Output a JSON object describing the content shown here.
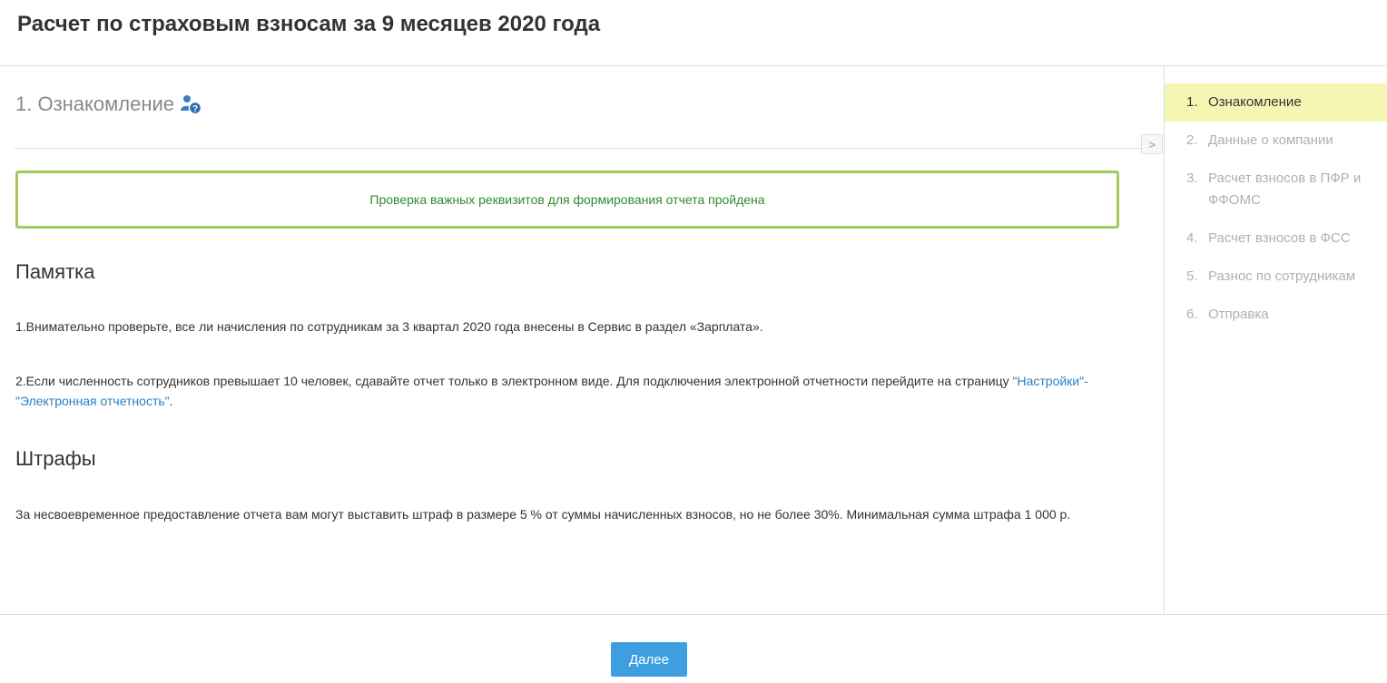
{
  "header": {
    "title": "Расчет по страховым взносам за 9 месяцев 2020 года"
  },
  "step": {
    "heading": "1. Ознакомление",
    "help_icon": "user-help-icon"
  },
  "check": {
    "message": "Проверка важных реквизитов для формирования отчета пройдена"
  },
  "memo": {
    "title": "Памятка",
    "item1": "1.Внимательно проверьте, все ли начисления по сотрудникам за 3 квартал 2020 года внесены в Сервис в раздел «Зарплата».",
    "item2_text": "2.Если численность сотрудников превышает 10 человек, сдавайте отчет только в электронном виде. Для подключения электронной отчетности перейдите на страницу ",
    "item2_link": "\"Настройки\"-\"Электронная отчетность\"",
    "item2_end": "."
  },
  "fines": {
    "title": "Штрафы",
    "text": "За несвоевременное предоставление отчета вам могут выставить штраф в размере 5 % от суммы начисленных взносов, но не более 30%. Минимальная сумма штрафа 1 000 р."
  },
  "collapse": {
    "label": ">"
  },
  "sidebar": {
    "items": [
      {
        "num": "1.",
        "label": "Ознакомление",
        "active": true
      },
      {
        "num": "2.",
        "label": "Данные о компании",
        "active": false
      },
      {
        "num": "3.",
        "label": "Расчет взносов в ПФР и ФФОМС",
        "active": false
      },
      {
        "num": "4.",
        "label": "Расчет взносов в ФСС",
        "active": false
      },
      {
        "num": "5.",
        "label": "Разнос по сотрудникам",
        "active": false
      },
      {
        "num": "6.",
        "label": "Отправка",
        "active": false
      }
    ]
  },
  "footer": {
    "next_label": "Далее"
  },
  "colors": {
    "accent": "#3d9fe0",
    "success_border": "#a7c85b",
    "success_text": "#2e8b2e",
    "active_nav": "#f6f6b4",
    "link": "#2a7fc1"
  }
}
